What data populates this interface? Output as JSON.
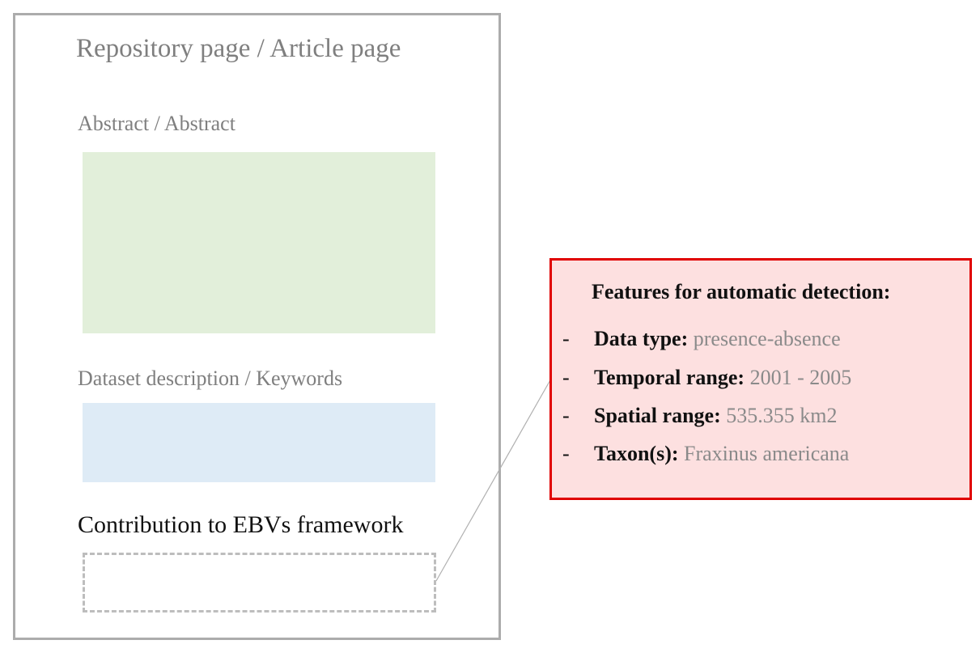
{
  "page": {
    "title": "Repository page / Article page",
    "abstract_label": "Abstract / Abstract",
    "dataset_label": "Dataset description / Keywords",
    "contribution_label": "Contribution to EBVs framework"
  },
  "features": {
    "title": "Features for automatic detection:",
    "dash": "-",
    "items": [
      {
        "key": "Data type:",
        "value": "presence-absence"
      },
      {
        "key": "Temporal range:",
        "value": "2001 - 2005"
      },
      {
        "key": "Spatial range:",
        "value": "535.355 km2"
      },
      {
        "key": "Taxon(s):",
        "value": "Fraxinus americana"
      }
    ]
  },
  "colors": {
    "frame_border": "#acacac",
    "abstract_fill": "#e2efda",
    "dataset_fill": "#deebf6",
    "dashed_border": "#bdbdbd",
    "features_fill": "#fde0e0",
    "features_border": "#e00000",
    "connector_line": "#b0b0b0"
  }
}
